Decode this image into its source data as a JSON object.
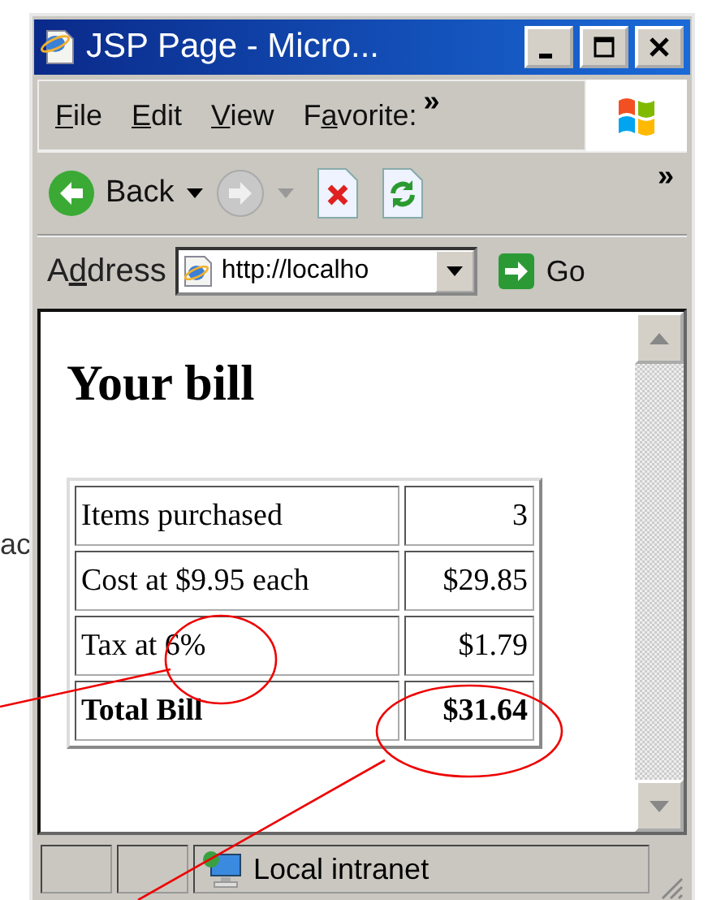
{
  "window": {
    "title": "JSP Page - Micro..."
  },
  "menu": [
    {
      "key": "F",
      "after": "ile"
    },
    {
      "key": "E",
      "after": "dit"
    },
    {
      "key": "V",
      "after": "iew"
    },
    {
      "before": "F",
      "key": "a",
      "after": "vorite:"
    }
  ],
  "menu_overflow": "»",
  "toolbar": {
    "back": "Back",
    "overflow": "»"
  },
  "address": {
    "before": "A",
    "key": "d",
    "after": "dress",
    "url": "http://localho",
    "go": "Go"
  },
  "page": {
    "heading": "Your bill",
    "rows": [
      {
        "label": "Items purchased",
        "value": "3",
        "total": false
      },
      {
        "label": "Cost at $9.95 each",
        "value": "$29.85",
        "total": false
      },
      {
        "label": "Tax at 6%",
        "value": "$1.79",
        "total": false
      },
      {
        "label": "Total Bill",
        "value": "$31.64",
        "total": true
      }
    ]
  },
  "status_bar": {
    "zone": "Local intranet"
  },
  "outside_text": "ac"
}
